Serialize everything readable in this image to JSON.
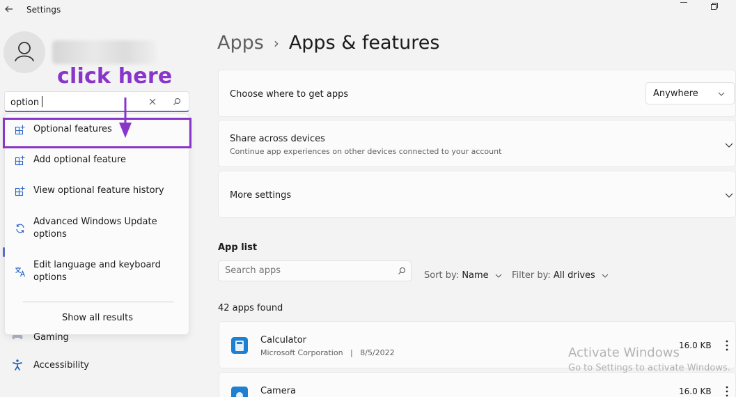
{
  "window": {
    "title": "Settings"
  },
  "annotation": {
    "text": "click here",
    "color": "#8a35c9"
  },
  "search": {
    "value": "option",
    "suggestions": [
      {
        "label": "Optional features",
        "icon": "grid-plus-icon"
      },
      {
        "label": "Add optional feature",
        "icon": "grid-plus-icon"
      },
      {
        "label": "View optional feature history",
        "icon": "grid-plus-icon"
      },
      {
        "label": "Advanced Windows Update options",
        "icon": "sync-icon"
      },
      {
        "label": "Edit language and keyboard options",
        "icon": "language-icon"
      }
    ],
    "show_all": "Show all results"
  },
  "sidebar": {
    "items": [
      {
        "label": "Gaming",
        "icon": "gamepad-icon"
      },
      {
        "label": "Accessibility",
        "icon": "accessibility-icon"
      }
    ]
  },
  "breadcrumb": {
    "parent": "Apps",
    "separator": "›",
    "current": "Apps & features"
  },
  "cards": {
    "source": {
      "title": "Choose where to get apps",
      "selected": "Anywhere"
    },
    "share": {
      "title": "Share across devices",
      "subtitle": "Continue app experiences on other devices connected to your account"
    },
    "more": {
      "title": "More settings"
    }
  },
  "app_list": {
    "title": "App list",
    "search_placeholder": "Search apps",
    "sort_label": "Sort by:",
    "sort_value": "Name",
    "filter_label": "Filter by:",
    "filter_value": "All drives",
    "count": "42 apps found",
    "apps": [
      {
        "name": "Calculator",
        "publisher": "Microsoft Corporation",
        "sep": "|",
        "date": "8/5/2022",
        "size": "16.0 KB"
      },
      {
        "name": "Camera",
        "publisher": "",
        "sep": "",
        "date": "",
        "size": "16.0 KB"
      }
    ]
  },
  "watermark": {
    "line1": "Activate Windows",
    "line2": "Go to Settings to activate Windows."
  },
  "colors": {
    "accent": "#5b6fbf",
    "annotation": "#8a35c9",
    "app_icon": "#1f7fd1"
  }
}
